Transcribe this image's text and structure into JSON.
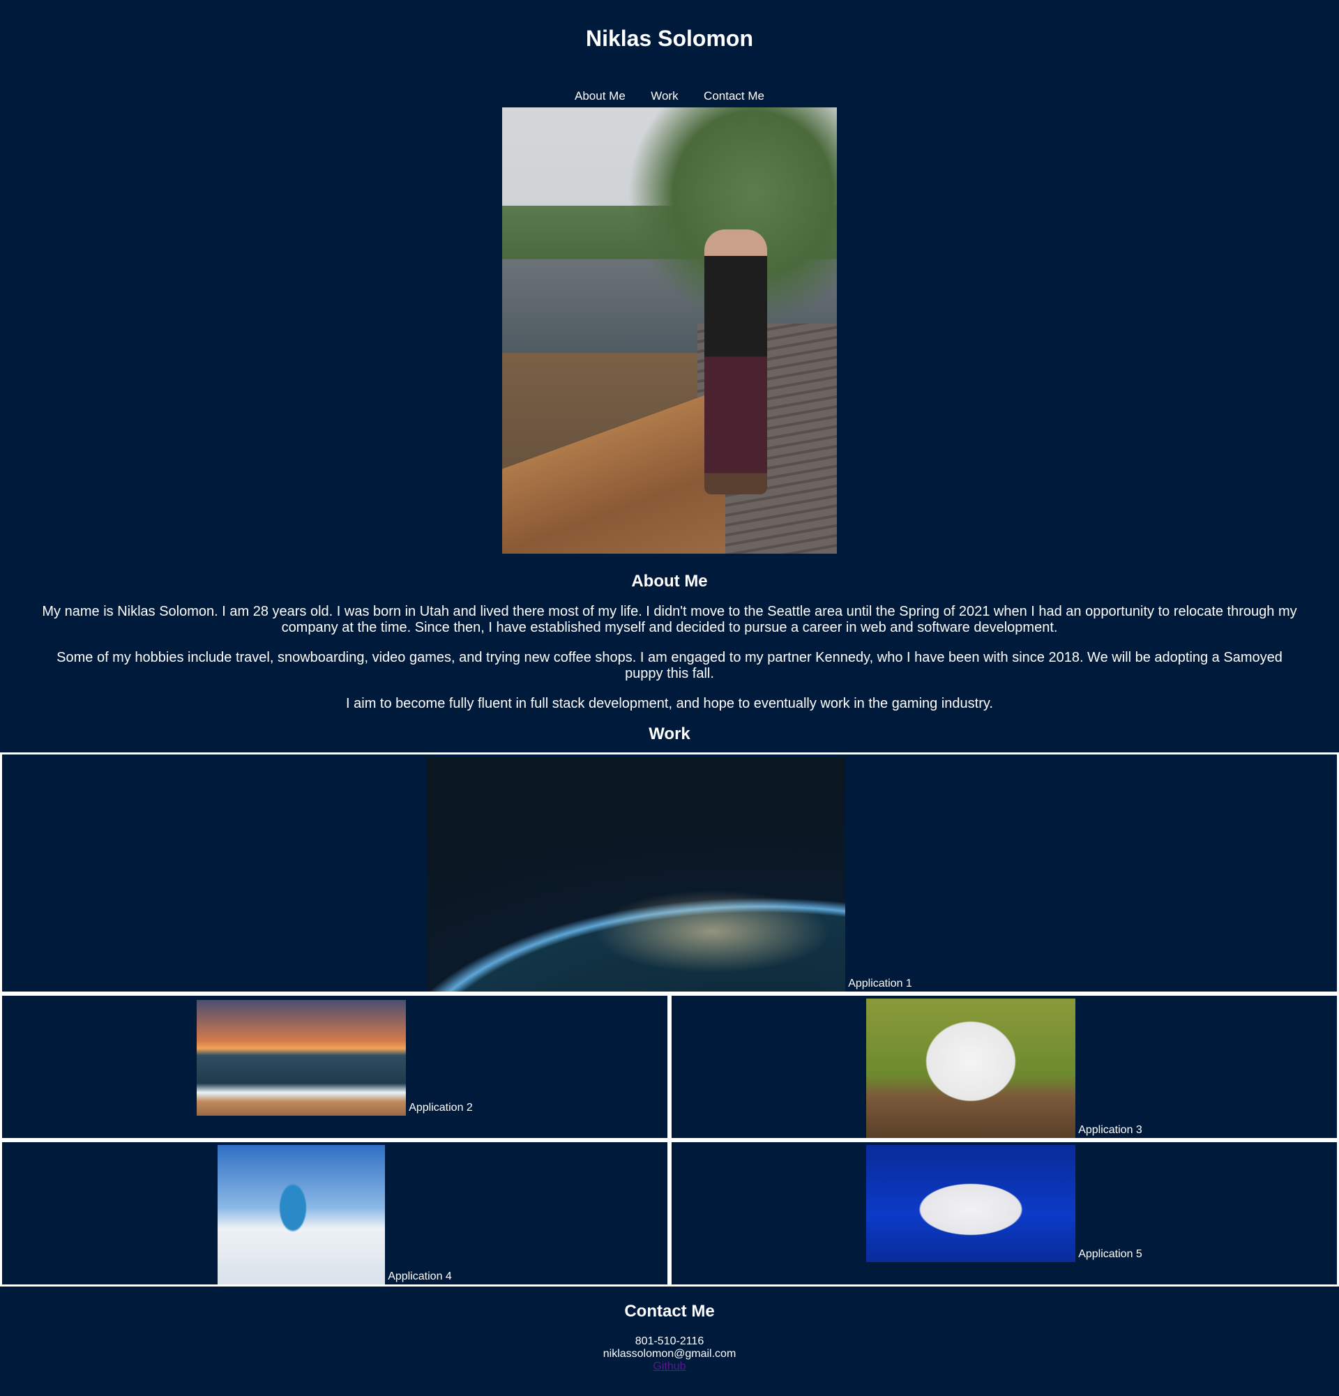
{
  "header": {
    "title": "Niklas Solomon"
  },
  "nav": {
    "items": [
      "About Me",
      "Work",
      "Contact Me"
    ]
  },
  "about": {
    "title": "About Me",
    "paragraphs": [
      "My name is Niklas Solomon. I am 28 years old. I was born in Utah and lived there most of my life. I didn't move to the Seattle area until the Spring of 2021 when I had an opportunity to relocate through my company at the time. Since then, I have established myself and decided to pursue a career in web and software development.",
      "Some of my hobbies include travel, snowboarding, video games, and trying new coffee shops. I am engaged to my partner Kennedy, who I have been with since 2018. We will be adopting a Samoyed puppy this fall.",
      "I aim to become fully fluent in full stack development, and hope to eventually work in the gaming industry."
    ]
  },
  "work": {
    "title": "Work",
    "applications": [
      {
        "label": "Application 1"
      },
      {
        "label": "Application 2"
      },
      {
        "label": "Application 3"
      },
      {
        "label": "Application 4"
      },
      {
        "label": "Application 5"
      }
    ]
  },
  "contact": {
    "title": "Contact Me",
    "phone": "801-510-2116",
    "email": "niklassolomon@gmail.com",
    "github_label": "Github"
  },
  "colors": {
    "background": "#001a3b",
    "text": "#ffffff",
    "card_border": "#ffffff",
    "visited_link": "#551a8b"
  }
}
